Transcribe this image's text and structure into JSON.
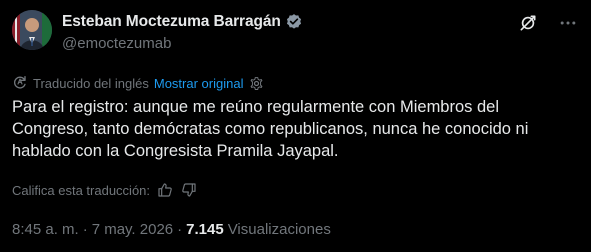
{
  "author": {
    "display_name": "Esteban Moctezuma Barragán",
    "handle": "@emoctezumab",
    "verified": true
  },
  "translation": {
    "label": "Traducido del inglés",
    "show_original": "Mostrar original"
  },
  "tweet": {
    "text": "Para el registro: aunque me reúno regularmente con Miembros del Congreso, tanto demócratas como republicanos, nunca he conocido ni hablado con la Congresista Pramila Jayapal."
  },
  "rating": {
    "prompt": "Califica esta traducción:"
  },
  "meta": {
    "time": "8:45 a. m.",
    "separator": "·",
    "date": "7 may. 2026",
    "views_count": "7.145",
    "views_label": "Visualizaciones"
  },
  "icons": {
    "verified": "verified-badge-icon",
    "grok": "grok-icon",
    "more": "more-options-icon",
    "translate": "translate-icon",
    "settings": "settings-icon",
    "thumbs_up": "thumbs-up-icon",
    "thumbs_down": "thumbs-down-icon"
  },
  "colors": {
    "background": "#000000",
    "text_primary": "#e7e9ea",
    "text_secondary": "#71767b",
    "link": "#1d9bf0"
  }
}
